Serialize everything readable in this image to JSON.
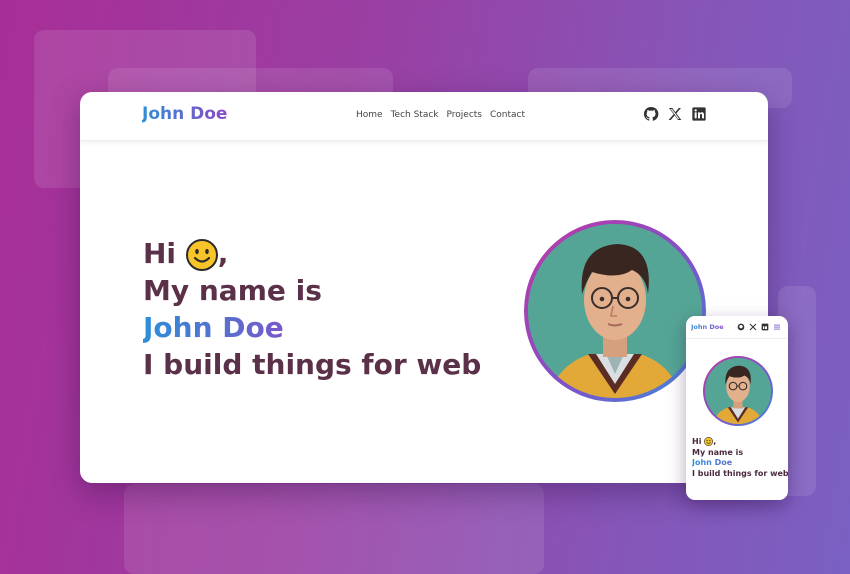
{
  "desktop": {
    "logo": "John Doe",
    "nav": [
      "Home",
      "Tech Stack",
      "Projects",
      "Contact"
    ],
    "social_icons": [
      "github-icon",
      "x-icon",
      "linkedin-icon"
    ],
    "hero": {
      "greeting": "Hi",
      "greeting_suffix": ",",
      "intro": "My name is",
      "name": "John Doe",
      "tagline": "I build things for web"
    }
  },
  "mobile": {
    "logo": "John Doe",
    "icons": [
      "github-icon",
      "x-icon",
      "linkedin-icon",
      "menu-icon"
    ],
    "hero": {
      "greeting": "Hi",
      "greeting_suffix": ",",
      "intro": "My name is",
      "name": "John Doe",
      "tagline": "I build things for web"
    }
  },
  "colors": {
    "text": "#5b3149",
    "gradient_start": "#2d8fd9",
    "gradient_end": "#c03a9c",
    "background": "#9a3fa3"
  }
}
